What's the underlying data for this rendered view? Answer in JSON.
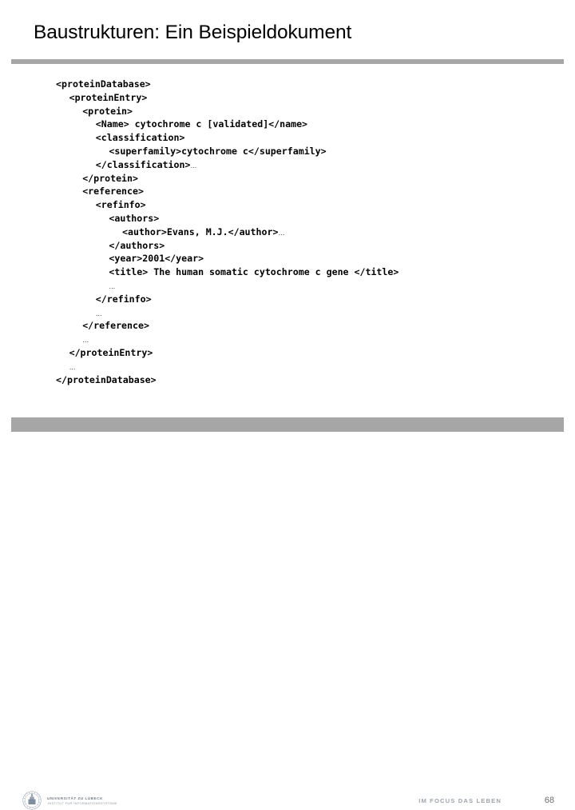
{
  "slide": {
    "title": "Baustrukturen: Ein Beispieldokument",
    "page_number": "68"
  },
  "theme": {
    "rule_color": "#a6a6a6",
    "title_color": "#000000",
    "code_color": "#000000",
    "footer_text_color": "#9aa6b2",
    "background": "#ffffff"
  },
  "code": {
    "language": "xml",
    "lines": [
      {
        "indent": 0,
        "text": "<proteinDatabase>",
        "ellipsis_after": false
      },
      {
        "indent": 1,
        "text": "<proteinEntry>",
        "ellipsis_after": false
      },
      {
        "indent": 2,
        "text": "<protein>",
        "ellipsis_after": false
      },
      {
        "indent": 3,
        "text": "<Name> cytochrome c [validated]</name>",
        "ellipsis_after": false
      },
      {
        "indent": 3,
        "text": "<classification>",
        "ellipsis_after": false
      },
      {
        "indent": 4,
        "text": "<superfamily>cytochrome c</superfamily>",
        "ellipsis_after": false
      },
      {
        "indent": 3,
        "text": "</classification>",
        "ellipsis_after": true
      },
      {
        "indent": 2,
        "text": "</protein>",
        "ellipsis_after": false
      },
      {
        "indent": 2,
        "text": "<reference>",
        "ellipsis_after": false
      },
      {
        "indent": 3,
        "text": "<refinfo>",
        "ellipsis_after": false
      },
      {
        "indent": 4,
        "text": "<authors>",
        "ellipsis_after": false
      },
      {
        "indent": 5,
        "text": "<author>Evans, M.J.</author>",
        "ellipsis_after": true
      },
      {
        "indent": 4,
        "text": "</authors>",
        "ellipsis_after": false
      },
      {
        "indent": 4,
        "text": "<year>2001</year>",
        "ellipsis_after": false
      },
      {
        "indent": 4,
        "text": "<title> The human somatic cytochrome c gene </title>",
        "ellipsis_after": false
      },
      {
        "indent": 4,
        "text": "…",
        "ellipsis_after": false,
        "ellipsis_only": true
      },
      {
        "indent": 3,
        "text": "</refinfo>",
        "ellipsis_after": false
      },
      {
        "indent": 3,
        "text": "…",
        "ellipsis_after": false,
        "ellipsis_only": true
      },
      {
        "indent": 2,
        "text": "</reference>",
        "ellipsis_after": false
      },
      {
        "indent": 2,
        "text": "…",
        "ellipsis_after": false,
        "ellipsis_only": true
      },
      {
        "indent": 1,
        "text": "</proteinEntry>",
        "ellipsis_after": false
      },
      {
        "indent": 1,
        "text": "…",
        "ellipsis_after": false,
        "ellipsis_only": true
      },
      {
        "indent": 0,
        "text": "</proteinDatabase>",
        "ellipsis_after": false
      }
    ]
  },
  "footer": {
    "university_name": "UNIVERSITÄT ZU LÜBECK",
    "institute_name": "INSTITUT FÜR INFORMATIONSSYSTEME",
    "tagline": "IM FOCUS DAS LEBEN",
    "seal_icon": "university-seal-icon"
  }
}
